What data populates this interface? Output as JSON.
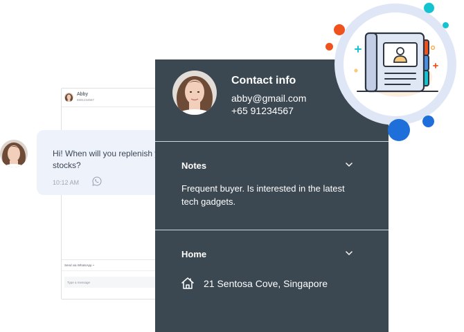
{
  "chat": {
    "contact_name": "Abby",
    "contact_phone": "6591234567",
    "send_via_label": "Send via WhatsApp",
    "compose_placeholder": "Type a message"
  },
  "message": {
    "text": "Hi! When will you replenish yo\nstocks?",
    "time": "10:12 AM"
  },
  "contact_info": {
    "title": "Contact info",
    "email": "abby@gmail.com",
    "phone": "+65 91234567",
    "notes": {
      "label": "Notes",
      "text": "Frequent buyer. Is interested in the latest tech gadgets."
    },
    "home": {
      "label": "Home",
      "address": "21 Sentosa Cove, Singapore"
    }
  },
  "colors": {
    "panel_bg": "#3b4852",
    "bubble_bg": "#eef2fb",
    "accent_blue": "#1f6fdb",
    "accent_orange": "#f0521e",
    "accent_teal": "#13c4d0",
    "ring": "#dfe7f6"
  },
  "icons": {
    "whatsapp": "whatsapp-icon",
    "chevron": "chevron-down-icon",
    "home": "home-icon",
    "address_book": "address-book-icon"
  }
}
